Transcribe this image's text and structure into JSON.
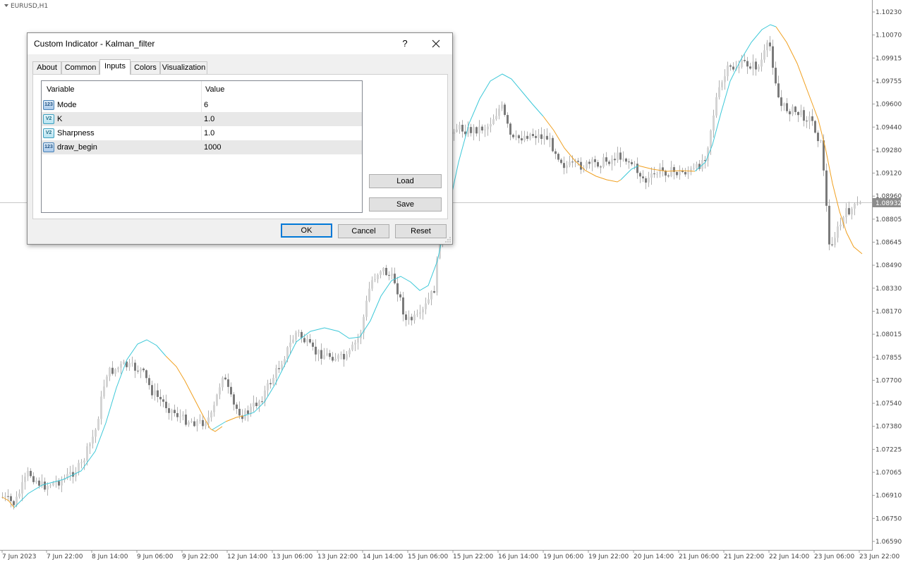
{
  "chart": {
    "symbol": "EURUSD,H1",
    "price_labels": [
      "1.10230",
      "1.10070",
      "1.09915",
      "1.09755",
      "1.09600",
      "1.09440",
      "1.09280",
      "1.09120",
      "1.08960",
      "1.08805",
      "1.08645",
      "1.08490",
      "1.08330",
      "1.08170",
      "1.08015",
      "1.07855",
      "1.07700",
      "1.07540",
      "1.07380",
      "1.07225",
      "1.07065",
      "1.06910",
      "1.06750",
      "1.06590"
    ],
    "current_price": "1.08932",
    "time_labels": [
      "7 Jun 2023",
      "7 Jun 22:00",
      "8 Jun 14:00",
      "9 Jun 06:00",
      "9 Jun 22:00",
      "12 Jun 14:00",
      "13 Jun 06:00",
      "13 Jun 22:00",
      "14 Jun 14:00",
      "15 Jun 06:00",
      "15 Jun 22:00",
      "16 Jun 14:00",
      "19 Jun 06:00",
      "19 Jun 22:00",
      "20 Jun 14:00",
      "21 Jun 06:00",
      "21 Jun 22:00",
      "22 Jun 14:00",
      "23 Jun 06:00",
      "23 Jun 22:00"
    ],
    "colors": {
      "up_line": "#3cc8d8",
      "down_line": "#f0a020",
      "candle": "#8c8c8c",
      "grid": "#c8c8c8"
    }
  },
  "dialog": {
    "title": "Custom Indicator - Kalman_filter",
    "help": "?",
    "tabs": [
      "About",
      "Common",
      "Inputs",
      "Colors",
      "Visualization"
    ],
    "active_tab": "Inputs",
    "grid": {
      "col_variable": "Variable",
      "col_value": "Value",
      "rows": [
        {
          "icon": "123",
          "type": "int",
          "name": "Mode",
          "value": "6"
        },
        {
          "icon": "V2",
          "type": "dbl",
          "name": "K",
          "value": "1.0"
        },
        {
          "icon": "V2",
          "type": "dbl",
          "name": "Sharpness",
          "value": "1.0"
        },
        {
          "icon": "123",
          "type": "int",
          "name": "draw_begin",
          "value": "1000"
        }
      ]
    },
    "buttons": {
      "load": "Load",
      "save": "Save",
      "ok": "OK",
      "cancel": "Cancel",
      "reset": "Reset"
    }
  }
}
